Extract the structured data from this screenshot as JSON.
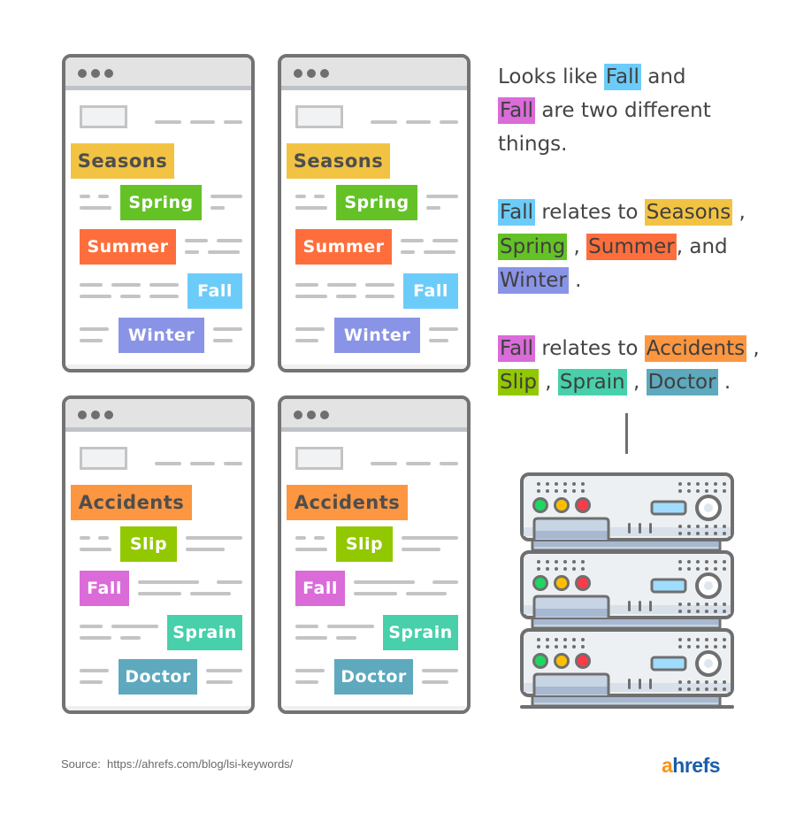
{
  "colors": {
    "seasons": "#f2c343",
    "spring": "#64c227",
    "summer": "#fe6e3c",
    "fall_season": "#6cccf9",
    "winter": "#8a94e6",
    "accidents": "#fc9641",
    "slip": "#92c800",
    "fall_accident": "#da6bd8",
    "sprain": "#47d0aa",
    "doctor": "#5ea9bd",
    "frame": "#737373",
    "placeholder_line": "#c4c4c4"
  },
  "browsers": [
    {
      "name": "seasons-page-1",
      "category": "Seasons",
      "terms": [
        "Spring",
        "Summer",
        "Fall",
        "Winter"
      ]
    },
    {
      "name": "seasons-page-2",
      "category": "Seasons",
      "terms": [
        "Spring",
        "Summer",
        "Fall",
        "Winter"
      ]
    },
    {
      "name": "accidents-page-1",
      "category": "Accidents",
      "terms": [
        "Slip",
        "Fall",
        "Sprain",
        "Doctor"
      ]
    },
    {
      "name": "accidents-page-2",
      "category": "Accidents",
      "terms": [
        "Slip",
        "Fall",
        "Sprain",
        "Doctor"
      ]
    }
  ],
  "notes": {
    "intro": {
      "line1_pre": "Looks like",
      "line1_term": "Fall",
      "line1_post": "and",
      "line2_term": "Fall",
      "line2_post": "are two different",
      "line3": "things."
    },
    "seasons": {
      "term": "Fall",
      "relates": "relates to",
      "items": [
        "Seasons",
        "Spring",
        "Summer",
        "Winter"
      ],
      "sep_comma": ",",
      "and": ", and",
      "period": "."
    },
    "accidents": {
      "term": "Fall",
      "relates": "relates to",
      "items": [
        "Accidents",
        "Slip",
        "Sprain",
        "Doctor"
      ],
      "sep_comma": ",",
      "period": "."
    }
  },
  "footer": {
    "source_label": "Source:",
    "source_url": "https://ahrefs.com/blog/lsi-keywords/",
    "logo_a": "a",
    "logo_rest": "hrefs"
  }
}
